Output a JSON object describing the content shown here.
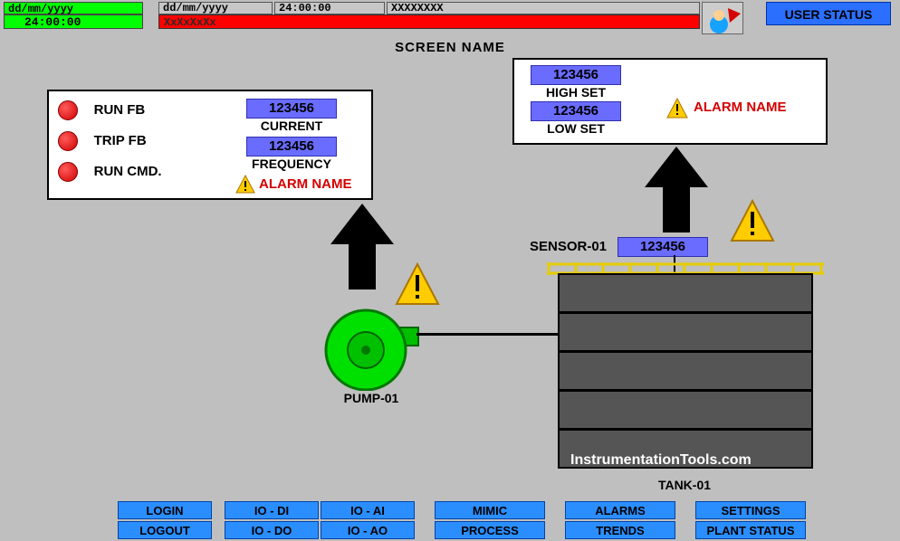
{
  "header": {
    "date1": "dd/mm/yyyy",
    "time1": "24:00:00",
    "date2": "dd/mm/yyyy",
    "time2": "24:00:00",
    "tag": "XXXXXXXX",
    "banner": "XxXxXxXx"
  },
  "user_status": "USER STATUS",
  "screen_name": "SCREEN NAME",
  "pump_panel": {
    "run_fb": "RUN FB",
    "trip_fb": "TRIP FB",
    "run_cmd": "RUN CMD.",
    "current_val": "123456",
    "current_label": "CURRENT",
    "freq_val": "123456",
    "freq_label": "FREQUENCY",
    "alarm": "ALARM NAME"
  },
  "sensor_panel": {
    "high_val": "123456",
    "high_label": "HIGH SET",
    "low_val": "123456",
    "low_label": "LOW SET",
    "alarm": "ALARM NAME"
  },
  "equipment": {
    "pump_label": "PUMP-01",
    "sensor_label": "SENSOR-01",
    "sensor_val": "123456",
    "tank_label": "TANK-01"
  },
  "watermark": "InstrumentationTools.com",
  "nav": {
    "login": "LOGIN",
    "logout": "LOGOUT",
    "io_di": "IO - DI",
    "io_do": "IO - DO",
    "io_ai": "IO - AI",
    "io_ao": "IO - AO",
    "mimic": "MIMIC",
    "process": "PROCESS",
    "alarms": "ALARMS",
    "trends": "TRENDS",
    "settings": "SETTINGS",
    "plant_status": "PLANT STATUS"
  }
}
